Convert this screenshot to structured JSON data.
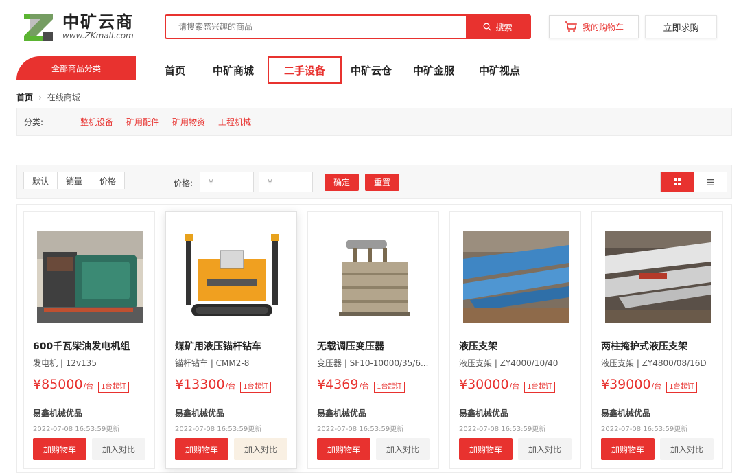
{
  "header": {
    "logo_cn": "中矿云商",
    "logo_en": "www.ZKmall.com",
    "search_placeholder": "请搜索感兴趣的商品",
    "search_button": "搜索",
    "cart_button": "我的购物车",
    "buy_request_button": "立即求购"
  },
  "nav": {
    "category_button": "全部商品分类",
    "items": [
      {
        "label": "首页"
      },
      {
        "label": "中矿商城"
      },
      {
        "label": "二手设备",
        "active": true
      },
      {
        "label": "中矿云仓"
      },
      {
        "label": "中矿金服"
      },
      {
        "label": "中矿视点"
      }
    ]
  },
  "breadcrumb": {
    "home": "首页",
    "current": "在线商城"
  },
  "categories": {
    "label": "分类:",
    "items": [
      "整机设备",
      "矿用配件",
      "矿用物资",
      "工程机械"
    ]
  },
  "filters": {
    "sort": [
      "默认",
      "销量",
      "价格"
    ],
    "price_label": "价格:",
    "price_min_placeholder": "¥",
    "price_max_placeholder": "¥",
    "price_dash": "-",
    "confirm": "确定",
    "reset": "重置"
  },
  "products": [
    {
      "title": "600千瓦柴油发电机组",
      "spec": "发电机 | 12v135",
      "price": "¥85000",
      "unit": "/台",
      "moq": "1台起订",
      "seller": "易鑫机械优品",
      "date": "2022-07-08 16:53:59更新",
      "add_cart": "加购物车",
      "compare": "加入对比"
    },
    {
      "title": "煤矿用液压锚杆钻车",
      "spec": "锚杆钻车 | CMM2-8",
      "price": "¥13300",
      "unit": "/台",
      "moq": "1台起订",
      "seller": "易鑫机械优品",
      "date": "2022-07-08 16:53:59更新",
      "add_cart": "加购物车",
      "compare": "加入对比"
    },
    {
      "title": "无载调压变压器",
      "spec": "变压器 | SF10-10000/35/6...",
      "price": "¥4369",
      "unit": "/台",
      "moq": "1台起订",
      "seller": "易鑫机械优品",
      "date": "2022-07-08 16:53:59更新",
      "add_cart": "加购物车",
      "compare": "加入对比"
    },
    {
      "title": "液压支架",
      "spec": "液压支架 | ZY4000/10/40",
      "price": "¥30000",
      "unit": "/台",
      "moq": "1台起订",
      "seller": "易鑫机械优品",
      "date": "2022-07-08 16:53:59更新",
      "add_cart": "加购物车",
      "compare": "加入对比"
    },
    {
      "title": "两柱掩护式液压支架",
      "spec": "液压支架 | ZY4800/08/16D",
      "price": "¥39000",
      "unit": "/台",
      "moq": "1台起订",
      "seller": "易鑫机械优品",
      "date": "2022-07-08 16:53:59更新",
      "add_cart": "加购物车",
      "compare": "加入对比"
    }
  ],
  "colors": {
    "accent": "#e8322f",
    "logo_green": "#5bb432"
  }
}
